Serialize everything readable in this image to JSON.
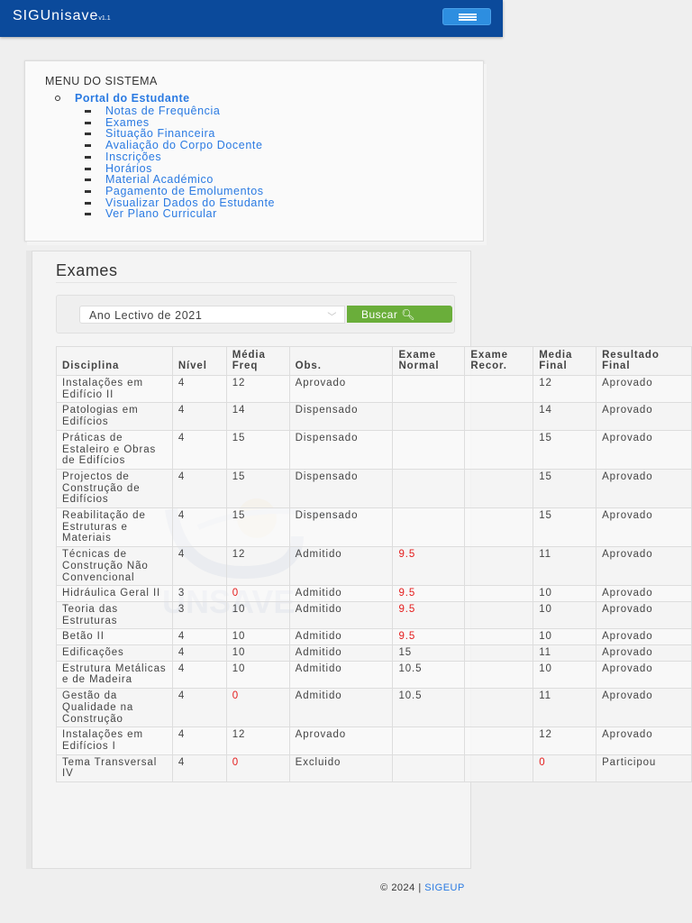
{
  "app": {
    "brand": "SIGUnisave",
    "version": "v1.1",
    "menu_toggle": "menu-icon"
  },
  "menu": {
    "title": "MENU DO SISTEMA",
    "portal": "Portal do Estudante",
    "items": [
      "Notas de Frequência",
      "Exames",
      "Situação Financeira",
      "Avaliação do Corpo Docente",
      "Inscrições",
      "Horários",
      "Material Académico",
      "Pagamento de Emolumentos",
      "Visualizar Dados do Estudante",
      "Ver Plano Curricular"
    ]
  },
  "exames": {
    "title": "Exames",
    "select_value": "Ano Lectivo de 2021",
    "buscar_label": "Buscar",
    "headers": [
      "Disciplina",
      "Nível",
      "Média Freq",
      "Obs.",
      "Exame Normal",
      "Exame Recor.",
      "Media Final",
      "Resultado Final"
    ],
    "rows": [
      [
        "Instalações em Edifício II",
        "4",
        "12",
        "Aprovado",
        "",
        "",
        "12",
        "Aprovado"
      ],
      [
        "Patologias em Edifícios",
        "4",
        "14",
        "Dispensado",
        "",
        "",
        "14",
        "Aprovado"
      ],
      [
        "Práticas de Estaleiro e Obras de Edifícios",
        "4",
        "15",
        "Dispensado",
        "",
        "",
        "15",
        "Aprovado"
      ],
      [
        "Projectos de Construção de Edifícios",
        "4",
        "15",
        "Dispensado",
        "",
        "",
        "15",
        "Aprovado"
      ],
      [
        "Reabilitação de Estruturas e Materiais",
        "4",
        "15",
        "Dispensado",
        "",
        "",
        "15",
        "Aprovado"
      ],
      [
        "Técnicas de Construção Não Convencional",
        "4",
        "12",
        "Admitido",
        "9.5",
        "",
        "11",
        "Aprovado"
      ],
      [
        "Hidráulica Geral II",
        "3",
        "0",
        "Admitido",
        "9.5",
        "",
        "10",
        "Aprovado"
      ],
      [
        "Teoria das Estruturas",
        "3",
        "10",
        "Admitido",
        "9.5",
        "",
        "10",
        "Aprovado"
      ],
      [
        "Betão II",
        "4",
        "10",
        "Admitido",
        "9.5",
        "",
        "10",
        "Aprovado"
      ],
      [
        "Edificações",
        "4",
        "10",
        "Admitido",
        "15",
        "",
        "11",
        "Aprovado"
      ],
      [
        "Estrutura Metálicas e de Madeira",
        "4",
        "10",
        "Admitido",
        "10.5",
        "",
        "10",
        "Aprovado"
      ],
      [
        "Gestão da Qualidade na Construção",
        "4",
        "0",
        "Admitido",
        "10.5",
        "",
        "11",
        "Aprovado"
      ],
      [
        "Instalações em Edifícios I",
        "4",
        "12",
        "Aprovado",
        "",
        "",
        "12",
        "Aprovado"
      ],
      [
        "Tema Transversal IV",
        "4",
        "0",
        "Excluido",
        "",
        "",
        "0",
        "Participou"
      ]
    ]
  },
  "footer": {
    "copy": "© 2024 | ",
    "link": "SIGEUP"
  },
  "colors": {
    "navbar": "#0b4a9b",
    "link": "#2a7ae2",
    "button": "#6aae3a",
    "fail": "#e41b1b"
  }
}
